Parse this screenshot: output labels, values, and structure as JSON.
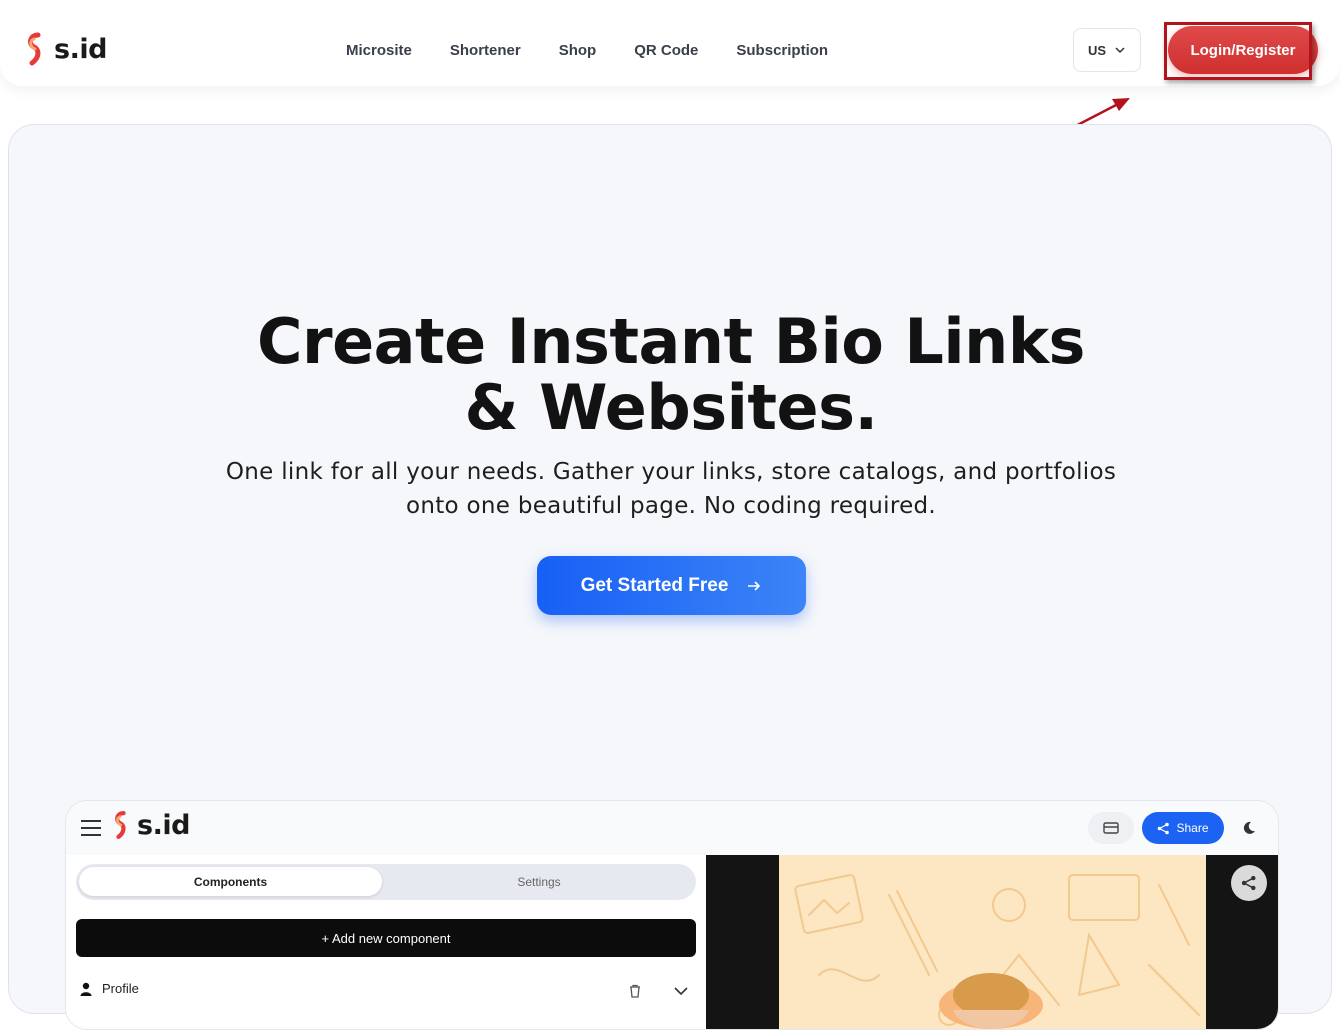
{
  "brand": {
    "name": "s.id",
    "accent_color": "#e53b3b",
    "primary_blue": "#1a62f5"
  },
  "nav": {
    "links": [
      "Microsite",
      "Shortener",
      "Shop",
      "QR Code",
      "Subscription"
    ],
    "language": "US",
    "login_label": "Login/Register"
  },
  "annotation": {
    "highlight": "login-register-button",
    "color": "#b1141c"
  },
  "hero": {
    "title_line1": "Create Instant Bio Links",
    "title_line2": "& Websites.",
    "subtitle_line1": "One link for all your needs. Gather your links, store catalogs, and portfolios",
    "subtitle_line2": "onto one beautiful page. No coding required.",
    "cta_label": "Get Started Free"
  },
  "preview": {
    "logo_text": "s.id",
    "share_label": "Share",
    "tabs": [
      "Components",
      "Settings"
    ],
    "active_tab": "Components",
    "add_component_label": "+ Add new component",
    "profile_label": "Profile"
  },
  "icons": [
    "chevron-down-icon",
    "arrow-right-icon",
    "menu-icon",
    "card-icon",
    "share-icon",
    "moon-icon",
    "user-icon",
    "trash-icon"
  ]
}
